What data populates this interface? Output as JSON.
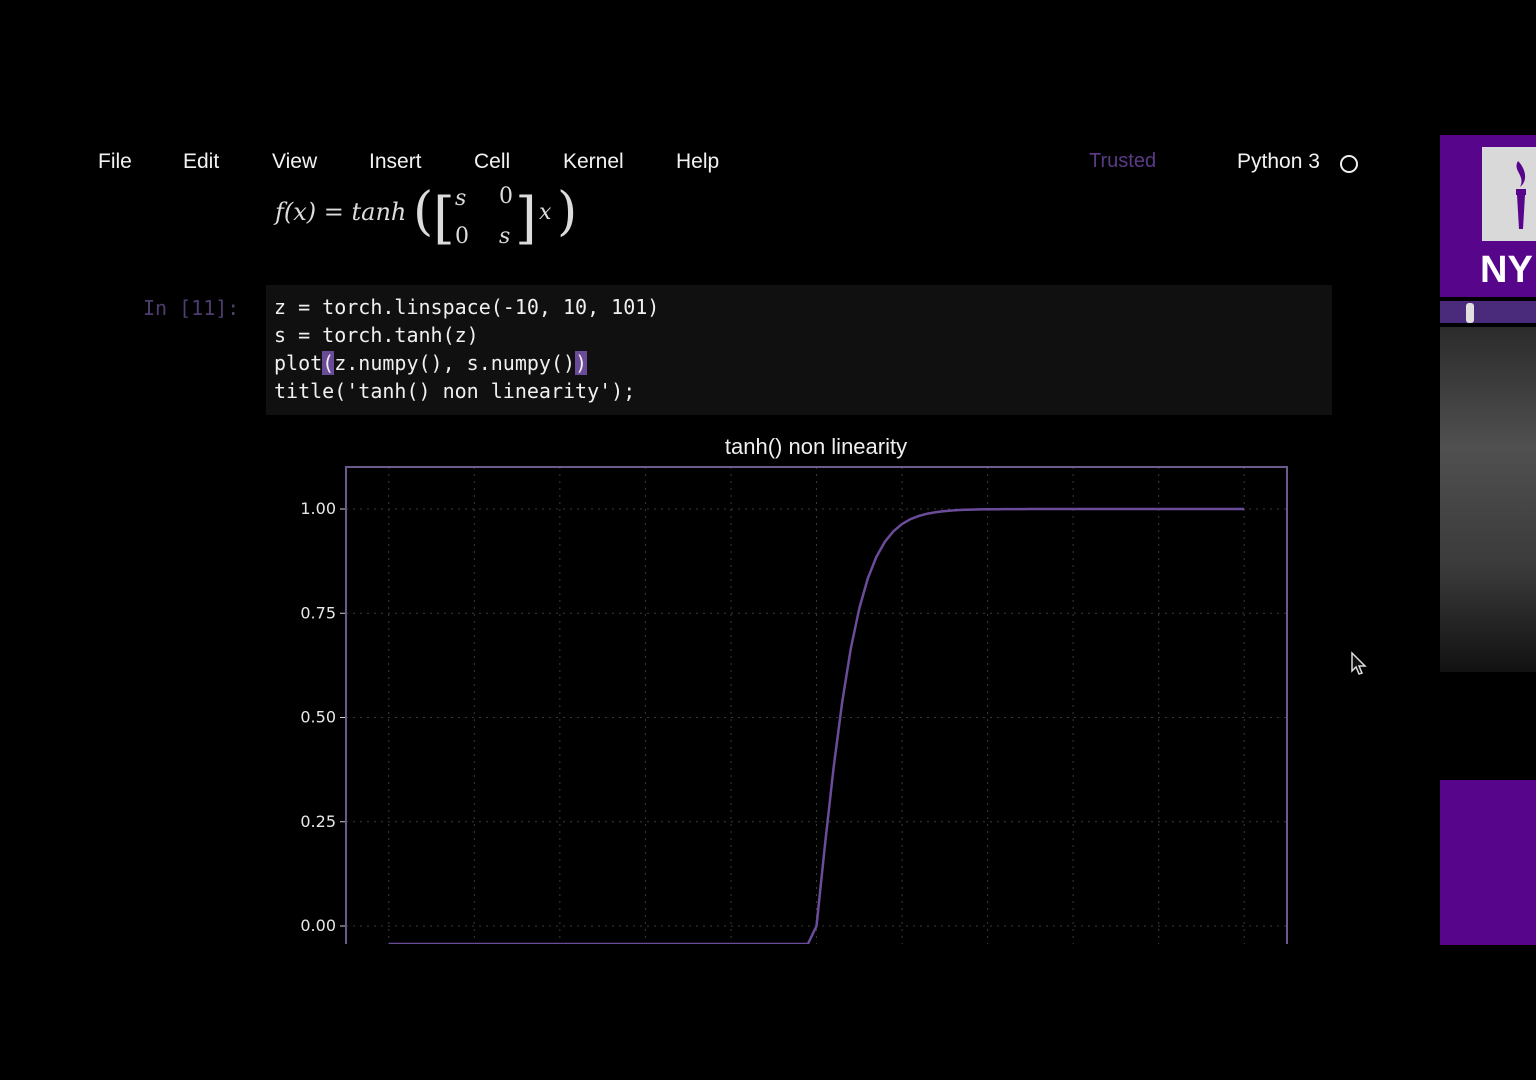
{
  "menu": {
    "items": [
      "File",
      "Edit",
      "View",
      "Insert",
      "Cell",
      "Kernel",
      "Help"
    ],
    "trusted": "Trusted",
    "kernel": "Python 3"
  },
  "math": {
    "lhs": "f(x) = tanh",
    "m11": "s",
    "m12": "0",
    "m21": "0",
    "m22": "s",
    "x": "x"
  },
  "cell": {
    "prompt": "In [11]:",
    "line1": "z = torch.linspace(-10, 10, 101)",
    "line2": "s = torch.tanh(z)",
    "line3_pre": "plot",
    "line3_paren_open": "(",
    "line3_mid": "z.numpy(), s.numpy()",
    "line3_paren_close": ")",
    "line4": "title('tanh() non linearity');"
  },
  "side_panel": {
    "logo_text": "NY"
  },
  "colors": {
    "accent": "#57068c",
    "line": "#6b4c9a",
    "grid": "#3a3a3a"
  },
  "chart_data": {
    "type": "line",
    "title": "tanh() non linearity",
    "xlabel": "",
    "ylabel": "",
    "xlim": [
      -11,
      11
    ],
    "ylim": [
      -0.08,
      1.1
    ],
    "yticks": [
      "0.00",
      "0.25",
      "0.50",
      "0.75",
      "1.00"
    ],
    "ytick_values": [
      0,
      0.25,
      0.5,
      0.75,
      1.0
    ],
    "grid": true,
    "series": [
      {
        "function": "tanh",
        "x_range": [
          -10,
          10
        ],
        "num_points": 101
      }
    ]
  }
}
